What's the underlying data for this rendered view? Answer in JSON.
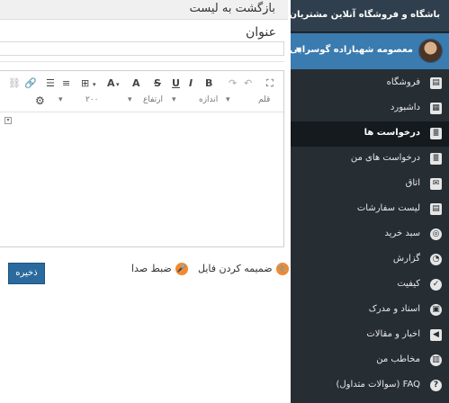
{
  "main": {
    "back_label": "بازگشت به لیست",
    "title_label": "عنوان",
    "title_value": ""
  },
  "editor": {
    "toolbar": {
      "bold": "B",
      "italic": "I",
      "underline": "U",
      "strike": "S",
      "font_color": "A",
      "bg_color": "A",
      "font_dropdown": "قلم",
      "size_dropdown": "اندازه",
      "height_dropdown": "ارتفاع",
      "zoom_value": "۲۰۰"
    }
  },
  "actions": {
    "attach_label": "ضمیمه کردن فایل",
    "record_label": "ضبط صدا",
    "save_label": "ذخیره"
  },
  "sidebar": {
    "brand": "باشگاه و فروشگاه آنلاین مشتریان",
    "user_name": "معصومه شهبازاده گوسرابی",
    "items": [
      {
        "label": "فروشگاه",
        "icon": "clipboard-icon"
      },
      {
        "label": "داشبورد",
        "icon": "grid-icon"
      },
      {
        "label": "درخواست ها",
        "icon": "document-icon"
      },
      {
        "label": "درخواست های من",
        "icon": "document-list-icon"
      },
      {
        "label": "اتاق",
        "icon": "chat-icon"
      },
      {
        "label": "لیست سفارشات",
        "icon": "clipboard-list-icon"
      },
      {
        "label": "سبد خرید",
        "icon": "cart-icon"
      },
      {
        "label": "گزارش",
        "icon": "report-icon"
      },
      {
        "label": "کیفیت",
        "icon": "quality-icon"
      },
      {
        "label": "اسناد و مدرک",
        "icon": "documents-icon"
      },
      {
        "label": "اخبار و مقالات",
        "icon": "megaphone-icon"
      },
      {
        "label": "مخاطب من",
        "icon": "contacts-icon"
      },
      {
        "label": "FAQ (سوالات متداول)",
        "icon": "help-icon"
      }
    ],
    "active_index": 2
  }
}
